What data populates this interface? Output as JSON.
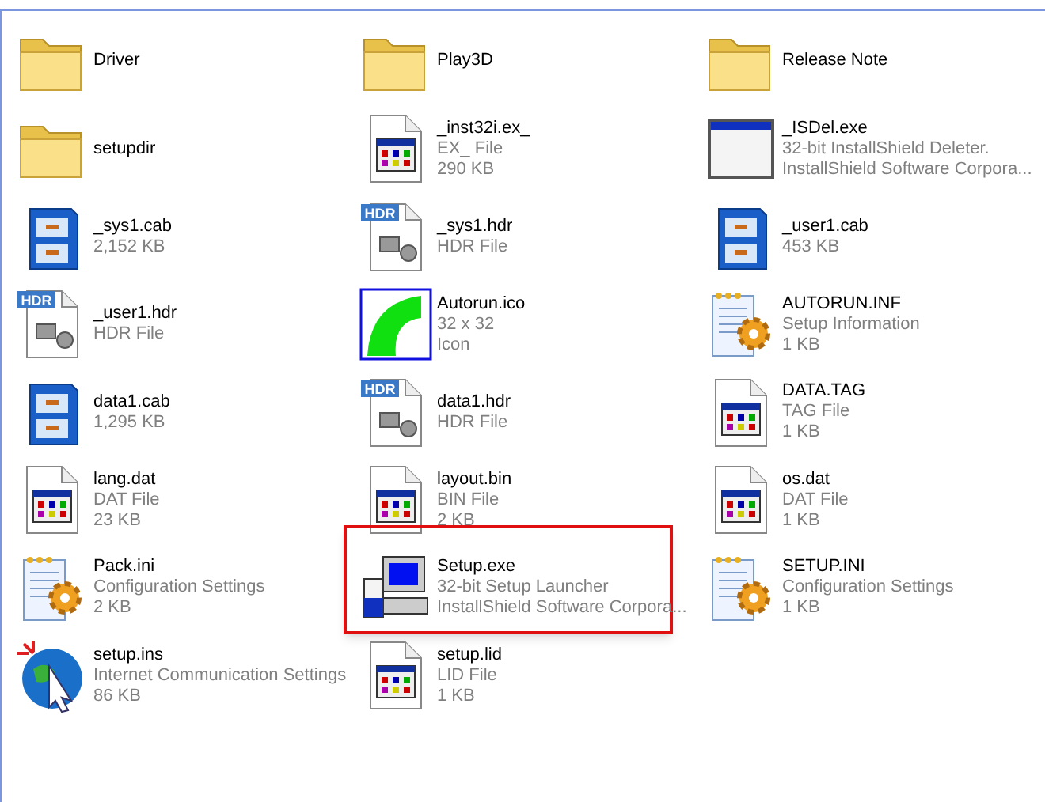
{
  "items": [
    {
      "name": "Driver",
      "kind": "folder",
      "highlighted": false
    },
    {
      "name": "Play3D",
      "kind": "folder",
      "highlighted": false
    },
    {
      "name": "Release Note",
      "kind": "folder",
      "highlighted": false
    },
    {
      "name": "setupdir",
      "kind": "folder",
      "highlighted": false
    },
    {
      "name": "_inst32i.ex_",
      "details": [
        "EX_ File",
        "290 KB"
      ],
      "kind": "file",
      "highlighted": false
    },
    {
      "name": "_ISDel.exe",
      "details": [
        "32-bit InstallShield Deleter.",
        "InstallShield Software Corpora..."
      ],
      "kind": "window",
      "highlighted": false
    },
    {
      "name": "_sys1.cab",
      "details": [
        "2,152 KB"
      ],
      "kind": "cabinet",
      "highlighted": false
    },
    {
      "name": "_sys1.hdr",
      "details": [
        "HDR File"
      ],
      "kind": "hdr",
      "badge": "HDR",
      "highlighted": false
    },
    {
      "name": "_user1.cab",
      "details": [
        "453 KB"
      ],
      "kind": "cabinet",
      "highlighted": false
    },
    {
      "name": "_user1.hdr",
      "details": [
        "HDR File"
      ],
      "kind": "hdr",
      "badge": "HDR",
      "highlighted": false
    },
    {
      "name": "Autorun.ico",
      "details": [
        "32 x 32",
        "Icon"
      ],
      "kind": "ico",
      "highlighted": false
    },
    {
      "name": "AUTORUN.INF",
      "details": [
        "Setup Information",
        "1 KB"
      ],
      "kind": "config",
      "highlighted": false
    },
    {
      "name": "data1.cab",
      "details": [
        "1,295 KB"
      ],
      "kind": "cabinet",
      "highlighted": false
    },
    {
      "name": "data1.hdr",
      "details": [
        "HDR File"
      ],
      "kind": "hdr",
      "badge": "HDR",
      "highlighted": false
    },
    {
      "name": "DATA.TAG",
      "details": [
        "TAG File",
        "1 KB"
      ],
      "kind": "file",
      "highlighted": false
    },
    {
      "name": "lang.dat",
      "details": [
        "DAT File",
        "23 KB"
      ],
      "kind": "file",
      "highlighted": false
    },
    {
      "name": "layout.bin",
      "details": [
        "BIN File",
        "2 KB"
      ],
      "kind": "file",
      "highlighted": false
    },
    {
      "name": "os.dat",
      "details": [
        "DAT File",
        "1 KB"
      ],
      "kind": "file",
      "highlighted": false
    },
    {
      "name": "Pack.ini",
      "details": [
        "Configuration Settings",
        "2 KB"
      ],
      "kind": "config",
      "highlighted": false
    },
    {
      "name": "Setup.exe",
      "details": [
        "32-bit Setup Launcher",
        "InstallShield Software Corpora..."
      ],
      "kind": "setup",
      "highlighted": true
    },
    {
      "name": "SETUP.INI",
      "details": [
        "Configuration Settings",
        "1 KB"
      ],
      "kind": "config",
      "highlighted": false
    },
    {
      "name": "setup.ins",
      "details": [
        "Internet Communication Settings",
        "86 KB"
      ],
      "kind": "internet",
      "highlighted": false
    },
    {
      "name": "setup.lid",
      "details": [
        "LID File",
        "1 KB"
      ],
      "kind": "file",
      "highlighted": false
    }
  ]
}
